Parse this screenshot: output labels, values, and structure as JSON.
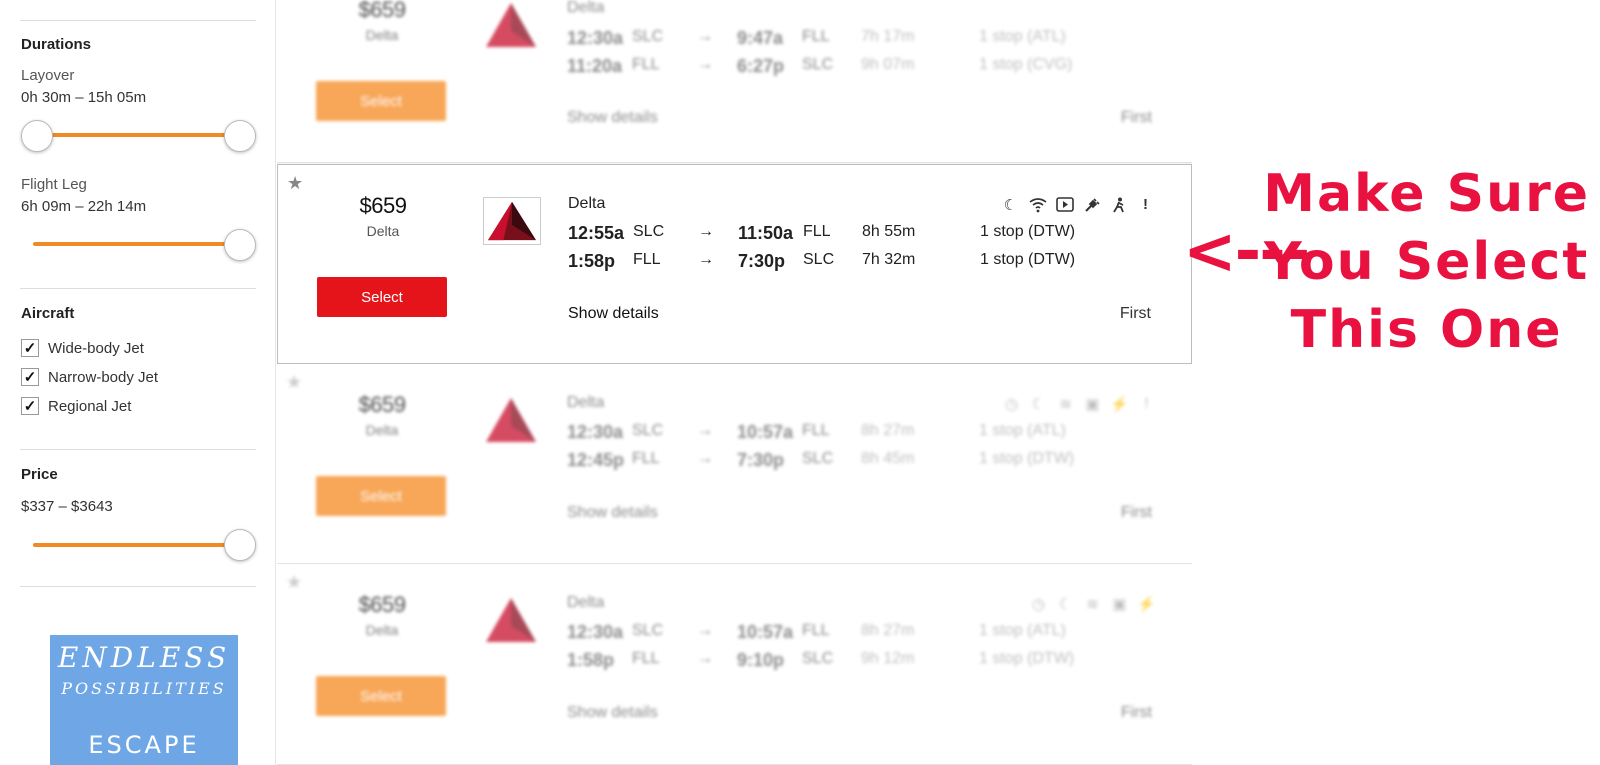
{
  "sidebar": {
    "durations_heading": "Durations",
    "layover": {
      "label": "Layover",
      "range": "0h 30m – 15h 05m"
    },
    "flight_leg": {
      "label": "Flight Leg",
      "range": "6h 09m – 22h 14m"
    },
    "aircraft_heading": "Aircraft",
    "aircraft": [
      {
        "label": "Wide-body Jet",
        "checked": "✓"
      },
      {
        "label": "Narrow-body Jet",
        "checked": "✓"
      },
      {
        "label": "Regional Jet",
        "checked": "✓"
      }
    ],
    "price_heading": "Price",
    "price_range": "$337 – $3643",
    "ad": {
      "line1": "ENDLESS",
      "line2": "POSSIBILITIES",
      "line3": "ESCAPE"
    }
  },
  "results": [
    {
      "price": "$659",
      "airline": "Delta",
      "select_label": "Select",
      "legs": [
        {
          "dep": "12:30a",
          "from": "SLC",
          "arrow": "→",
          "arr": "9:47a",
          "to": "FLL",
          "duration": "7h 17m",
          "stops": "1 stop (ATL)"
        },
        {
          "dep": "11:20a",
          "from": "FLL",
          "arrow": "→",
          "arr": "6:27p",
          "to": "SLC",
          "duration": "9h 07m",
          "stops": "1 stop (CVG)"
        }
      ],
      "show_details": "Show details",
      "cabin": "First"
    },
    {
      "price": "$659",
      "airline": "Delta",
      "select_label": "Select",
      "legs": [
        {
          "dep": "12:55a",
          "from": "SLC",
          "arrow": "→",
          "arr": "11:50a",
          "to": "FLL",
          "duration": "8h 55m",
          "stops": "1 stop (DTW)"
        },
        {
          "dep": "1:58p",
          "from": "FLL",
          "arrow": "→",
          "arr": "7:30p",
          "to": "SLC",
          "duration": "7h 32m",
          "stops": "1 stop (DTW)"
        }
      ],
      "show_details": "Show details",
      "cabin": "First",
      "amenity_note": "!"
    },
    {
      "price": "$659",
      "airline": "Delta",
      "select_label": "Select",
      "legs": [
        {
          "dep": "12:30a",
          "from": "SLC",
          "arrow": "→",
          "arr": "10:57a",
          "to": "FLL",
          "duration": "8h 27m",
          "stops": "1 stop (ATL)"
        },
        {
          "dep": "12:45p",
          "from": "FLL",
          "arrow": "→",
          "arr": "7:30p",
          "to": "SLC",
          "duration": "8h 45m",
          "stops": "1 stop (DTW)"
        }
      ],
      "show_details": "Show details",
      "cabin": "First",
      "amenity_note": "!"
    },
    {
      "price": "$659",
      "airline": "Delta",
      "select_label": "Select",
      "legs": [
        {
          "dep": "12:30a",
          "from": "SLC",
          "arrow": "→",
          "arr": "10:57a",
          "to": "FLL",
          "duration": "8h 27m",
          "stops": "1 stop (ATL)"
        },
        {
          "dep": "1:58p",
          "from": "FLL",
          "arrow": "→",
          "arr": "9:10p",
          "to": "SLC",
          "duration": "9h 12m",
          "stops": "1 stop (DTW)"
        }
      ],
      "show_details": "Show details",
      "cabin": "First"
    }
  ],
  "annotation": {
    "arrow": "<---",
    "line1": "Make Sure",
    "line2": "You Select",
    "line3": "This One",
    "color": "#e8113f"
  },
  "colors": {
    "select_orange": "#f6891f",
    "select_red": "#e5141b",
    "slider": "#f08a24"
  }
}
